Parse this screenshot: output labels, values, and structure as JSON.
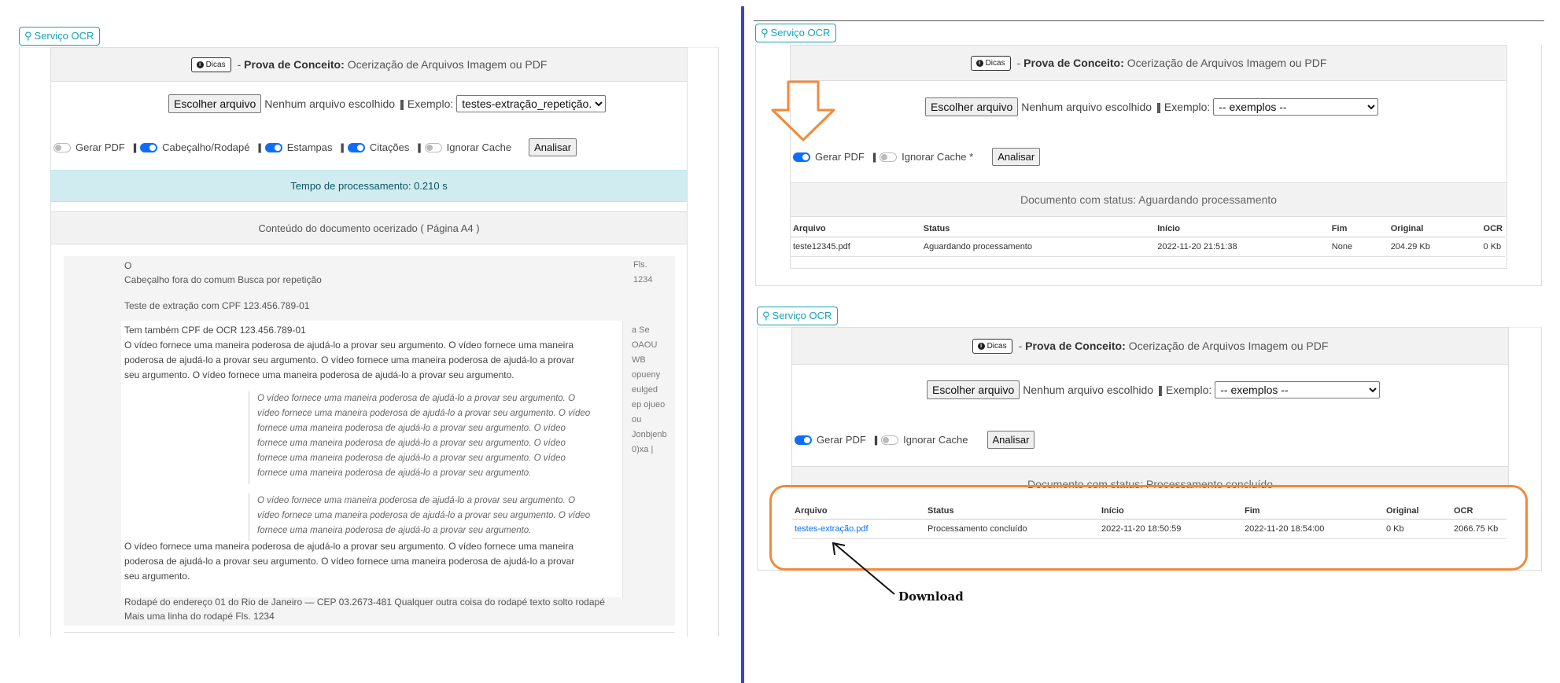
{
  "service_button": "Serviço OCR",
  "header": {
    "dicas": "Dicas",
    "title_bold": "Prova de Conceito:",
    "title_rest": "Ocerização de Arquivos Imagem ou PDF"
  },
  "file_input": {
    "choose_label": "Escolher arquivo",
    "no_file": "Nenhum arquivo escolhido",
    "separator": "||",
    "example_label": "Exemplo:"
  },
  "left_panel": {
    "example_selected": "testes-extração_repetição.pdf",
    "options": [
      {
        "label": "Gerar PDF",
        "on": false
      },
      {
        "label": "Cabeçalho/Rodapé",
        "on": true
      },
      {
        "label": "Estampas",
        "on": true
      },
      {
        "label": "Citações",
        "on": true
      },
      {
        "label": "Ignorar Cache",
        "on": false
      }
    ],
    "analyze_label": "Analisar",
    "processing_time": "Tempo de processamento: 0.210 s",
    "content_title": "Conteúdo do documento ocerizado ( Página A4 )",
    "doc": {
      "header_o": "O",
      "header_line": "Cabeçalho fora do comum Busca por repetição",
      "header_side_1": "Fls.",
      "header_side_2": "1234",
      "cpf_line": "Teste de extração com CPF 123.456.789-01",
      "ocr_cpf_line": "Tem também CPF de OCR 123.456.789-01",
      "para_1": [
        "O vídeo fornece uma maneira poderosa de ajudá-lo a provar seu argumento. O vídeo fornece uma maneira",
        "poderosa de ajudá-lo a provar seu argumento. O vídeo fornece uma maneira poderosa de ajudá-lo a provar",
        "seu argumento. O vídeo fornece uma maneira poderosa de ajudá-lo a provar seu argumento."
      ],
      "quote_1": [
        "O vídeo fornece uma maneira poderosa de ajudá-lo a provar seu argumento. O",
        "vídeo fornece uma maneira poderosa de ajudá-lo a provar seu argumento. O vídeo",
        "fornece uma maneira poderosa de ajudá-lo a provar seu argumento. O vídeo",
        "fornece uma maneira poderosa de ajudá-lo a provar seu argumento. O vídeo",
        "fornece uma maneira poderosa de ajudá-lo a provar seu argumento. O vídeo",
        "fornece uma maneira poderosa de ajudá-lo a provar seu argumento."
      ],
      "quote_2": [
        "O vídeo fornece uma maneira poderosa de ajudá-lo a provar seu argumento. O",
        "vídeo fornece uma maneira poderosa de ajudá-lo a provar seu argumento. O vídeo",
        "fornece uma maneira poderosa de ajudá-lo a provar seu argumento."
      ],
      "para_2": [
        "O vídeo fornece uma maneira poderosa de ajudá-lo a provar seu argumento. O vídeo fornece uma maneira",
        "poderosa de ajudá-lo a provar seu argumento. O vídeo fornece uma maneira poderosa de ajudá-lo a provar",
        "seu argumento."
      ],
      "stamp_side": [
        "a Se",
        "OAOU",
        "WB",
        "opueny",
        "eulged",
        "ep ojueo",
        "ou",
        "Jonbjenb",
        "0)xa |"
      ],
      "footer_1": "Rodapé do endereço 01 do Rio de Janeiro — CEP 03.2673-481 Qualquer outra coisa do rodapé texto solto rodapé",
      "footer_2": "Mais uma linha do rodapé Fls. 1234"
    }
  },
  "top_right": {
    "example_selected": "-- exemplos --",
    "options": [
      {
        "label": "Gerar PDF",
        "on": true
      },
      {
        "label": "Ignorar Cache *",
        "on": false
      }
    ],
    "analyze_label": "Analisar",
    "status": "Documento com status: Aguardando processamento",
    "table": {
      "headers": [
        "Arquivo",
        "Status",
        "Início",
        "Fim",
        "Original",
        "OCR"
      ],
      "row": [
        "teste12345.pdf",
        "Aguardando processamento",
        "2022-11-20 21:51:38",
        "None",
        "204.29 Kb",
        "0 Kb"
      ]
    }
  },
  "bottom_right": {
    "example_selected": "-- exemplos --",
    "options": [
      {
        "label": "Gerar PDF",
        "on": true
      },
      {
        "label": "Ignorar Cache",
        "on": false
      }
    ],
    "analyze_label": "Analisar",
    "status": "Documento com status: Processamento concluído",
    "table": {
      "headers": [
        "Arquivo",
        "Status",
        "Início",
        "Fim",
        "Original",
        "OCR"
      ],
      "row": [
        "testes-extração.pdf",
        "Processamento concluído",
        "2022-11-20 18:50:59",
        "2022-11-20 18:54:00",
        "0 Kb",
        "2066.75 Kb"
      ]
    }
  },
  "annotation": {
    "download_label": "Download"
  },
  "colors": {
    "accent": "#17a2b8",
    "toggle_on": "#0d6efd",
    "annotation_orange": "#f08a3c",
    "divider_blue": "#3b45c4"
  }
}
